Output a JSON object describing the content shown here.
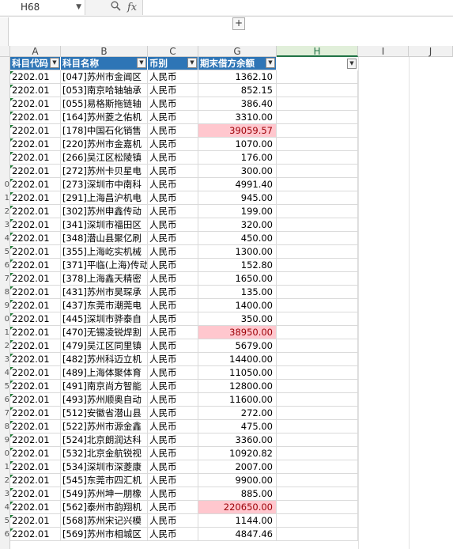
{
  "formula_bar": {
    "name_box": "H68",
    "fx_label": "fx",
    "search_icon": "magnifier-icon",
    "formula": ""
  },
  "columns": [
    {
      "id": "row",
      "label": ""
    },
    {
      "id": "A",
      "label": "A"
    },
    {
      "id": "B",
      "label": "B"
    },
    {
      "id": "C",
      "label": "C"
    },
    {
      "id": "G",
      "label": "G"
    },
    {
      "id": "H",
      "label": "H"
    },
    {
      "id": "I",
      "label": "I"
    },
    {
      "id": "J",
      "label": "J"
    }
  ],
  "header_row": [
    "科目代码",
    "科目名称",
    "币别",
    "期末借方余额"
  ],
  "row_numbers": [
    "",
    "",
    "",
    "",
    "",
    "",
    "",
    "",
    "",
    "0",
    "1",
    "2",
    "3",
    "4",
    "5",
    "6",
    "7",
    "8",
    "9",
    "0",
    "1",
    "2",
    "3",
    "4",
    "5",
    "6",
    "7",
    "8",
    "9",
    "0",
    "1",
    "2",
    "3",
    "4",
    "5",
    "6"
  ],
  "rows": [
    {
      "a": "2202.01",
      "b": "[047]苏州市金阊区",
      "c": "人民币",
      "g": "1362.10",
      "hl": false
    },
    {
      "a": "2202.01",
      "b": "[053]南京哈轴轴承",
      "c": "人民币",
      "g": "852.15",
      "hl": false
    },
    {
      "a": "2202.01",
      "b": "[055]易格斯拖链轴",
      "c": "人民币",
      "g": "386.40",
      "hl": false
    },
    {
      "a": "2202.01",
      "b": "[164]苏州菱之佑机",
      "c": "人民币",
      "g": "3310.00",
      "hl": false
    },
    {
      "a": "2202.01",
      "b": "[178]中国石化销售",
      "c": "人民币",
      "g": "39059.57",
      "hl": true
    },
    {
      "a": "2202.01",
      "b": "[220]苏州市金嘉机",
      "c": "人民币",
      "g": "1070.00",
      "hl": false
    },
    {
      "a": "2202.01",
      "b": "[266]吴江区松陵镇",
      "c": "人民币",
      "g": "176.00",
      "hl": false
    },
    {
      "a": "2202.01",
      "b": "[272]苏州卡贝星电",
      "c": "人民币",
      "g": "300.00",
      "hl": false
    },
    {
      "a": "2202.01",
      "b": "[273]深圳市中南科",
      "c": "人民币",
      "g": "4991.40",
      "hl": false
    },
    {
      "a": "2202.01",
      "b": "[291]上海昌沪机电",
      "c": "人民币",
      "g": "945.00",
      "hl": false
    },
    {
      "a": "2202.01",
      "b": "[302]苏州申鑫传动",
      "c": "人民币",
      "g": "199.00",
      "hl": false
    },
    {
      "a": "2202.01",
      "b": "[341]深圳市福田区",
      "c": "人民币",
      "g": "320.00",
      "hl": false
    },
    {
      "a": "2202.01",
      "b": "[348]潜山县聚亿刷",
      "c": "人民币",
      "g": "450.00",
      "hl": false
    },
    {
      "a": "2202.01",
      "b": "[355]上海屹实机械",
      "c": "人民币",
      "g": "1300.00",
      "hl": false
    },
    {
      "a": "2202.01",
      "b": "[371]平临(上海)传动",
      "c": "人民币",
      "g": "152.80",
      "hl": false
    },
    {
      "a": "2202.01",
      "b": "[378]上海鑫天精密",
      "c": "人民币",
      "g": "1650.00",
      "hl": false
    },
    {
      "a": "2202.01",
      "b": "[431]苏州市昊琛承",
      "c": "人民币",
      "g": "135.00",
      "hl": false
    },
    {
      "a": "2202.01",
      "b": "[437]东莞市潮莞电",
      "c": "人民币",
      "g": "1400.00",
      "hl": false
    },
    {
      "a": "2202.01",
      "b": "[445]深圳市骅泰自",
      "c": "人民币",
      "g": "350.00",
      "hl": false
    },
    {
      "a": "2202.01",
      "b": "[470]无锡凌锐焊割",
      "c": "人民币",
      "g": "38950.00",
      "hl": true
    },
    {
      "a": "2202.01",
      "b": "[479]吴江区同里镇",
      "c": "人民币",
      "g": "5679.00",
      "hl": false
    },
    {
      "a": "2202.01",
      "b": "[482]苏州科迈立机",
      "c": "人民币",
      "g": "14400.00",
      "hl": false
    },
    {
      "a": "2202.01",
      "b": "[489]上海体聚体育",
      "c": "人民币",
      "g": "11050.00",
      "hl": false
    },
    {
      "a": "2202.01",
      "b": "[491]南京尚方智能",
      "c": "人民币",
      "g": "12800.00",
      "hl": false
    },
    {
      "a": "2202.01",
      "b": "[493]苏州顺奥自动",
      "c": "人民币",
      "g": "11600.00",
      "hl": false
    },
    {
      "a": "2202.01",
      "b": "[512]安徽省潜山县",
      "c": "人民币",
      "g": "272.00",
      "hl": false
    },
    {
      "a": "2202.01",
      "b": "[522]苏州市源金鑫",
      "c": "人民币",
      "g": "475.00",
      "hl": false
    },
    {
      "a": "2202.01",
      "b": "[524]北京朗润达科",
      "c": "人民币",
      "g": "3360.00",
      "hl": false
    },
    {
      "a": "2202.01",
      "b": "[532]北京金航锐视",
      "c": "人民币",
      "g": "10920.82",
      "hl": false
    },
    {
      "a": "2202.01",
      "b": "[534]深圳市深菱康",
      "c": "人民币",
      "g": "2007.00",
      "hl": false
    },
    {
      "a": "2202.01",
      "b": "[545]东莞市四汇机",
      "c": "人民币",
      "g": "9900.00",
      "hl": false
    },
    {
      "a": "2202.01",
      "b": "[549]苏州坤一朋橡",
      "c": "人民币",
      "g": "885.00",
      "hl": false
    },
    {
      "a": "2202.01",
      "b": "[562]泰州市韵翔机",
      "c": "人民币",
      "g": "220650.00",
      "hl": true
    },
    {
      "a": "2202.01",
      "b": "[568]苏州宋记兴模",
      "c": "人民币",
      "g": "1144.00",
      "hl": false
    },
    {
      "a": "2202.01",
      "b": "[569]苏州市相城区",
      "c": "人民币",
      "g": "4847.46",
      "hl": false
    }
  ],
  "colors": {
    "header_fill": "#2e75b6",
    "highlight_fill": "#ffc7ce",
    "highlight_text": "#9c0006",
    "active_col": "#e1efda"
  }
}
